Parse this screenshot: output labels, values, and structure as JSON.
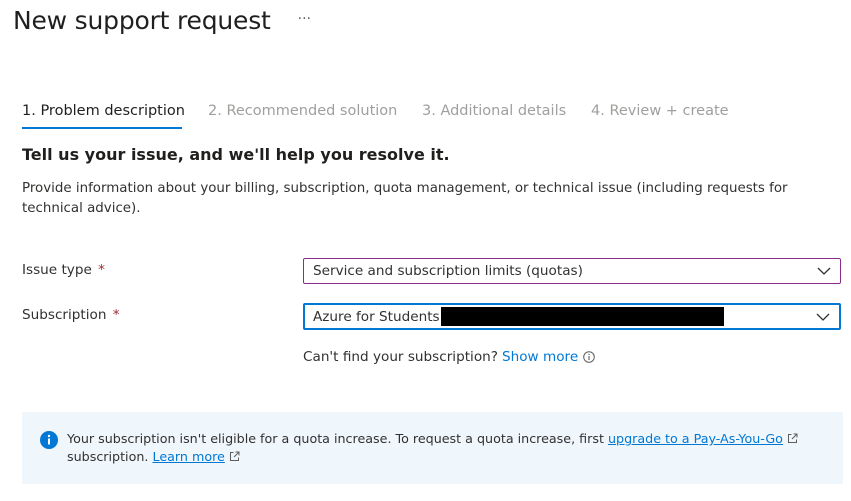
{
  "header": {
    "title": "New support request",
    "more_icon": "ellipsis-icon"
  },
  "steps": [
    {
      "label": "1. Problem description",
      "active": true
    },
    {
      "label": "2. Recommended solution",
      "active": false
    },
    {
      "label": "3. Additional details",
      "active": false
    },
    {
      "label": "4. Review + create",
      "active": false
    }
  ],
  "section": {
    "heading": "Tell us your issue, and we'll help you resolve it.",
    "description": "Provide information about your billing, subscription, quota management, or technical issue (including requests for technical advice)."
  },
  "form": {
    "issue_type": {
      "label": "Issue type",
      "required_marker": "*",
      "value": "Service and subscription limits (quotas)"
    },
    "subscription": {
      "label": "Subscription",
      "required_marker": "*",
      "value": "Azure for Students"
    },
    "find_subscription": {
      "text": "Can't find your subscription?",
      "link": "Show more"
    }
  },
  "banner": {
    "text_before_link": "Your subscription isn't eligible for a quota increase. To request a quota increase, first ",
    "upgrade_link": "upgrade to a Pay-As-You-Go",
    "text_after_link": " subscription. ",
    "learn_more_link": "Learn more"
  },
  "colors": {
    "accent": "#0078d4",
    "required": "#a4262c",
    "banner_bg": "#eff6fc",
    "inactive_step": "#a19f9d"
  }
}
